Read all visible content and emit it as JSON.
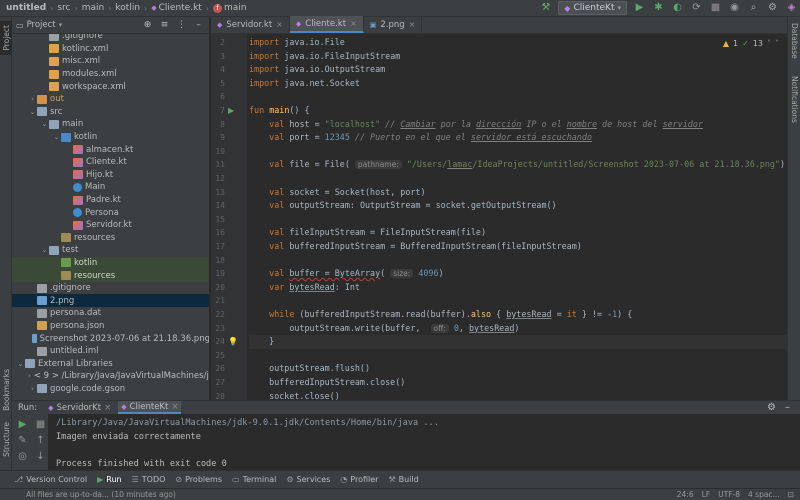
{
  "navbar": {
    "breadcrumbs": [
      "untitled",
      "src",
      "main",
      "kotlin",
      "Cliente.kt",
      "main"
    ],
    "run_config": "ClienteKt"
  },
  "left_stripe": {
    "project": "Project",
    "bookmarks": "Bookmarks",
    "structure": "Structure"
  },
  "right_stripe": {
    "database": "Database",
    "notifications": "Notifications"
  },
  "project_panel": {
    "title": "Project",
    "tree": [
      {
        "label": ".gitignore",
        "depth": 2,
        "icon": "file",
        "arrow": ""
      },
      {
        "label": "kotlinc.xml",
        "depth": 2,
        "icon": "xml",
        "arrow": ""
      },
      {
        "label": "misc.xml",
        "depth": 2,
        "icon": "xml",
        "arrow": ""
      },
      {
        "label": "modules.xml",
        "depth": 2,
        "icon": "xml",
        "arrow": ""
      },
      {
        "label": "workspace.xml",
        "depth": 2,
        "icon": "xml",
        "arrow": ""
      },
      {
        "label": "out",
        "depth": 1,
        "icon": "folder-orange",
        "arrow": "›",
        "style": "orange"
      },
      {
        "label": "src",
        "depth": 1,
        "icon": "folder",
        "arrow": "⌄"
      },
      {
        "label": "main",
        "depth": 2,
        "icon": "folder",
        "arrow": "⌄"
      },
      {
        "label": "kotlin",
        "depth": 3,
        "icon": "folder-blue",
        "arrow": "⌄"
      },
      {
        "label": "almacen.kt",
        "depth": 4,
        "icon": "kt",
        "arrow": ""
      },
      {
        "label": "Cliente.kt",
        "depth": 4,
        "icon": "kt",
        "arrow": ""
      },
      {
        "label": "Hijo.kt",
        "depth": 4,
        "icon": "kt",
        "arrow": ""
      },
      {
        "label": "Main",
        "depth": 4,
        "icon": "class",
        "arrow": ""
      },
      {
        "label": "Padre.kt",
        "depth": 4,
        "icon": "kt",
        "arrow": ""
      },
      {
        "label": "Persona",
        "depth": 4,
        "icon": "class",
        "arrow": ""
      },
      {
        "label": "Servidor.kt",
        "depth": 4,
        "icon": "kt",
        "arrow": ""
      },
      {
        "label": "resources",
        "depth": 3,
        "icon": "folder-res",
        "arrow": ""
      },
      {
        "label": "test",
        "depth": 2,
        "icon": "folder",
        "arrow": "⌄"
      },
      {
        "label": "kotlin",
        "depth": 3,
        "icon": "folder-green",
        "arrow": "",
        "style": "hl"
      },
      {
        "label": "resources",
        "depth": 3,
        "icon": "folder-res",
        "arrow": "",
        "style": "hl"
      },
      {
        "label": ".gitignore",
        "depth": 1,
        "icon": "file",
        "arrow": ""
      },
      {
        "label": "2.png",
        "depth": 1,
        "icon": "img",
        "arrow": "",
        "style": "sel"
      },
      {
        "label": "persona.dat",
        "depth": 1,
        "icon": "file",
        "arrow": ""
      },
      {
        "label": "persona.json",
        "depth": 1,
        "icon": "json",
        "arrow": ""
      },
      {
        "label": "Screenshot 2023-07-06 at 21.18.36.png",
        "depth": 1,
        "icon": "img",
        "arrow": ""
      },
      {
        "label": "untitled.iml",
        "depth": 1,
        "icon": "iml",
        "arrow": ""
      },
      {
        "label": "External Libraries",
        "depth": 0,
        "icon": "lib",
        "arrow": "⌄"
      },
      {
        "label": "< 9 > /Library/Java/JavaVirtualMachines/jdk",
        "depth": 1,
        "icon": "lib",
        "arrow": "›"
      },
      {
        "label": "google.code.gson",
        "depth": 1,
        "icon": "lib",
        "arrow": "›"
      }
    ]
  },
  "editor": {
    "tabs": [
      {
        "label": "Servidor.kt",
        "active": false
      },
      {
        "label": "Cliente.kt",
        "active": true
      },
      {
        "label": "2.png",
        "active": false
      }
    ],
    "inspections": {
      "warnings": "1",
      "weak": "13"
    },
    "current_line": 24,
    "lines": [
      {
        "n": 2,
        "html": "<span class='kw'>import</span> java.io.File"
      },
      {
        "n": 3,
        "html": "<span class='kw'>import</span> java.io.FileInputStream"
      },
      {
        "n": 4,
        "html": "<span class='kw'>import</span> java.io.OutputStream"
      },
      {
        "n": 5,
        "html": "<span class='kw'>import</span> java.net.Socket"
      },
      {
        "n": 6,
        "html": ""
      },
      {
        "n": 7,
        "html": "<span class='kw'>fun</span> <span class='fn'>main</span>() {"
      },
      {
        "n": 8,
        "html": "    <span class='kw'>val</span> host = <span class='str'>\"localhost\"</span> <span class='cmt'>// <span class='ul'>Cambiar</span> por la <span class='ul'>dirección</span> IP o el <span class='ul'>nombre</span> de host del <span class='ul'>servidor</span></span>"
      },
      {
        "n": 9,
        "html": "    <span class='kw'>val</span> port = <span class='num'>12345</span> <span class='cmt'>// Puerto en el que el <span class='ul'>servidor está escuchando</span></span>"
      },
      {
        "n": 10,
        "html": ""
      },
      {
        "n": 11,
        "html": "    <span class='kw'>val</span> file = File( <span class='hint'>pathname:</span> <span class='str'>\"/Users/<span class='ul'>lamac</span>/IdeaProjects/untitled/Screenshot 2023-07-06 at 21.18.36.png\"</span>) <span class='cmt'>//</span>"
      },
      {
        "n": 12,
        "html": ""
      },
      {
        "n": 13,
        "html": "    <span class='kw'>val</span> socket = Socket(host, port)"
      },
      {
        "n": 14,
        "html": "    <span class='kw'>val</span> outputStream: OutputStream = socket.getOutputStream()"
      },
      {
        "n": 15,
        "html": ""
      },
      {
        "n": 16,
        "html": "    <span class='kw'>val</span> fileInputStream = FileInputStream(file)"
      },
      {
        "n": 17,
        "html": "    <span class='kw'>val</span> bufferedInputStream = BufferedInputStream(fileInputStream)"
      },
      {
        "n": 18,
        "html": ""
      },
      {
        "n": 19,
        "html": "    <span class='kw'>val</span> <span class='wavy'>buffer = ByteArray</span>( <span class='hint'>size:</span> <span class='num'>4096</span>)"
      },
      {
        "n": 20,
        "html": "    <span class='kw'>var</span> <span class='ul'>bytesRead</span>: Int"
      },
      {
        "n": 21,
        "html": ""
      },
      {
        "n": 22,
        "html": "    <span class='kw'>while</span> (bufferedInputStream.read(buffer).<span class='fn'>also</span> { <span class='ul'>bytesRead</span> = <span class='kw'>it</span> } != -<span class='num'>1</span>) {"
      },
      {
        "n": 23,
        "html": "        outputStream.write(buffer,  <span class='hint'>off:</span> <span class='num'>0</span>, <span class='ul'>bytesRead</span>)"
      },
      {
        "n": 24,
        "html": "    }"
      },
      {
        "n": 25,
        "html": ""
      },
      {
        "n": 26,
        "html": "    outputStream.flush()"
      },
      {
        "n": 27,
        "html": "    bufferedInputStream.close()"
      },
      {
        "n": 28,
        "html": "    socket.close()"
      }
    ]
  },
  "run_panel": {
    "label": "Run:",
    "tabs": [
      {
        "label": "ServidorKt",
        "active": false
      },
      {
        "label": "ClienteKt",
        "active": true
      }
    ],
    "console": [
      "/Library/Java/JavaVirtualMachines/jdk-9.0.1.jdk/Contents/Home/bin/java ...",
      "Imagen enviada correctamente",
      "",
      "Process finished with exit code 0"
    ]
  },
  "bottom_tools": [
    "Version Control",
    "Run",
    "TODO",
    "Problems",
    "Terminal",
    "Services",
    "Profiler",
    "Build"
  ],
  "status": {
    "message": "All files are up-to-da... (10 minutes ago)",
    "position": "24:6",
    "line_sep": "LF",
    "encoding": "UTF-8",
    "indent": "4 spac..."
  }
}
